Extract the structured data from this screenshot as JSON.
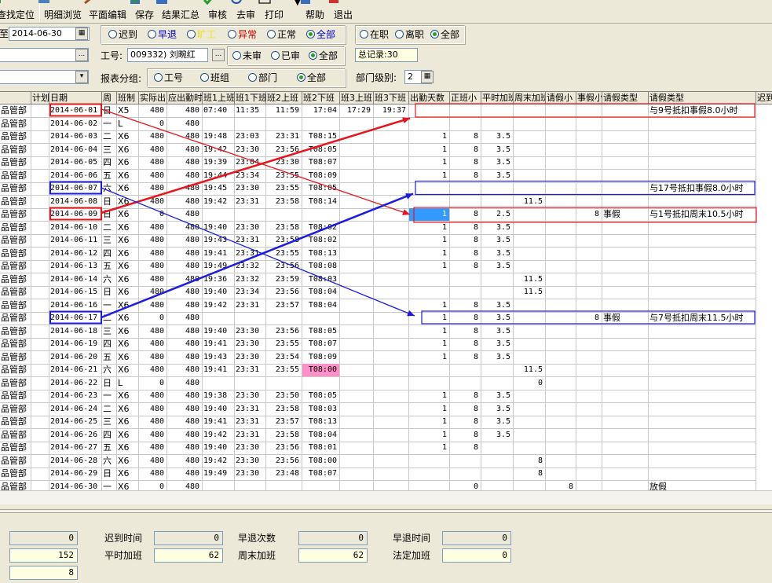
{
  "toolbar": {
    "items": [
      {
        "label": "查找定位",
        "icon": "search-icon"
      },
      {
        "label": "明细浏览",
        "icon": "list-icon"
      },
      {
        "label": "平面编辑",
        "icon": "edit-icon"
      },
      {
        "label": "保存",
        "icon": "save-icon"
      },
      {
        "label": "结果汇总",
        "icon": "summary-icon"
      },
      {
        "label": "审核",
        "icon": "check-icon"
      },
      {
        "label": "去审",
        "icon": "uncheck-icon"
      },
      {
        "label": "打印",
        "icon": "print-icon"
      },
      {
        "label": "帮助",
        "icon": "help-icon"
      },
      {
        "label": "退出",
        "icon": "exit-icon"
      }
    ]
  },
  "filters": {
    "date_to_prefix": "至",
    "date_to": "2014-06-30",
    "status_options": [
      {
        "label": "迟到",
        "selected": false,
        "color": "#000000"
      },
      {
        "label": "早退",
        "selected": false,
        "color": "#0000cc"
      },
      {
        "label": "旷工",
        "selected": false,
        "color": "#f0e020"
      },
      {
        "label": "异常",
        "selected": false,
        "color": "#cc0000"
      },
      {
        "label": "正常",
        "selected": false,
        "color": "#000000"
      },
      {
        "label": "全部",
        "selected": true,
        "color": "#0000cc"
      }
    ],
    "employment_options": [
      {
        "label": "在职",
        "selected": false
      },
      {
        "label": "离职",
        "selected": false
      },
      {
        "label": "全部",
        "selected": true
      }
    ],
    "employee_label": "工号:",
    "employee_value": "009332) 刘畹红",
    "audit_options": [
      {
        "label": "未审",
        "selected": false
      },
      {
        "label": "已审",
        "selected": false
      },
      {
        "label": "全部",
        "selected": true
      }
    ],
    "total_records": "总记录:30",
    "group_label": "报表分组:",
    "group_options": [
      {
        "label": "工号",
        "selected": false
      },
      {
        "label": "班组",
        "selected": false
      },
      {
        "label": "部门",
        "selected": false
      },
      {
        "label": "全部",
        "selected": true
      }
    ],
    "dept_level_label": "部门级别:",
    "dept_level_value": "2"
  },
  "table": {
    "headers": [
      "",
      "计划",
      "日期",
      "周",
      "班制",
      "实际出",
      "应出勤时",
      "班1上班",
      "班1下班",
      "班2上班",
      "班2下班",
      "班3上班",
      "班3下班",
      "出勤天数",
      "正班小",
      "平时加班",
      "周末加班",
      "请假小",
      "事假小",
      "请假类型",
      "请假类型",
      "迟到"
    ],
    "rows": [
      [
        "品管部",
        "",
        "2014-06-01",
        "日",
        "X5",
        "480",
        "480",
        "07:40",
        "11:35",
        "11:59",
        "17:04",
        "17:29",
        "19:37",
        "",
        "",
        "",
        "",
        "",
        "",
        "",
        "与9号抵扣事假8.0小时"
      ],
      [
        "品管部",
        "",
        "2014-06-02",
        "一",
        "L",
        "0",
        "480",
        "",
        "",
        "",
        "",
        "",
        "",
        "",
        "",
        "",
        "",
        "",
        "",
        "",
        ""
      ],
      [
        "品管部",
        "",
        "2014-06-03",
        "二",
        "X6",
        "480",
        "480",
        "19:48",
        "23:03",
        "23:31",
        "T08:15",
        "",
        "",
        "1",
        "8",
        "3.5",
        "",
        "",
        "",
        "",
        ""
      ],
      [
        "品管部",
        "",
        "2014-06-04",
        "三",
        "X6",
        "480",
        "480",
        "19:42",
        "23:30",
        "23:56",
        "T08:05",
        "",
        "",
        "1",
        "8",
        "3.5",
        "",
        "",
        "",
        "",
        ""
      ],
      [
        "品管部",
        "",
        "2014-06-05",
        "四",
        "X6",
        "480",
        "480",
        "19:39",
        "23:04",
        "23:30",
        "T08:07",
        "",
        "",
        "1",
        "8",
        "3.5",
        "",
        "",
        "",
        "",
        ""
      ],
      [
        "品管部",
        "",
        "2014-06-06",
        "五",
        "X6",
        "480",
        "480",
        "19:44",
        "23:34",
        "23:55",
        "T08:09",
        "",
        "",
        "1",
        "8",
        "3.5",
        "",
        "",
        "",
        "",
        ""
      ],
      [
        "品管部",
        "",
        "2014-06-07",
        "六",
        "X6",
        "480",
        "480",
        "19:45",
        "23:30",
        "23:55",
        "T08:05",
        "",
        "",
        "",
        "",
        "",
        "",
        "",
        "",
        "",
        "与17号抵扣事假8.0小时"
      ],
      [
        "品管部",
        "",
        "2014-06-08",
        "日",
        "X6",
        "480",
        "480",
        "19:42",
        "23:31",
        "23:58",
        "T08:14",
        "",
        "",
        "",
        "",
        "",
        "11.5",
        "",
        "",
        "",
        ""
      ],
      [
        "品管部",
        "",
        "2014-06-09",
        "日",
        "X6",
        "0",
        "480",
        "",
        "",
        "",
        "",
        "",
        "",
        "1",
        "8",
        "2.5",
        "",
        "",
        "8",
        "事假",
        "与1号抵扣周末10.5小时"
      ],
      [
        "品管部",
        "",
        "2014-06-10",
        "二",
        "X6",
        "480",
        "480",
        "19:40",
        "23:30",
        "23:58",
        "T08:02",
        "",
        "",
        "1",
        "8",
        "3.5",
        "",
        "",
        "",
        "",
        ""
      ],
      [
        "品管部",
        "",
        "2014-06-11",
        "三",
        "X6",
        "480",
        "480",
        "19:43",
        "23:31",
        "23:58",
        "T08:02",
        "",
        "",
        "1",
        "8",
        "3.5",
        "",
        "",
        "",
        "",
        ""
      ],
      [
        "品管部",
        "",
        "2014-06-12",
        "四",
        "X6",
        "480",
        "480",
        "19:41",
        "23:31",
        "23:55",
        "T08:13",
        "",
        "",
        "1",
        "8",
        "3.5",
        "",
        "",
        "",
        "",
        ""
      ],
      [
        "品管部",
        "",
        "2014-06-13",
        "五",
        "X6",
        "480",
        "480",
        "19:49",
        "23:32",
        "23:56",
        "T08:08",
        "",
        "",
        "1",
        "8",
        "3.5",
        "",
        "",
        "",
        "",
        ""
      ],
      [
        "品管部",
        "",
        "2014-06-14",
        "六",
        "X6",
        "480",
        "480",
        "19:36",
        "23:32",
        "23:59",
        "T08:03",
        "",
        "",
        "",
        "",
        "",
        "11.5",
        "",
        "",
        "",
        ""
      ],
      [
        "品管部",
        "",
        "2014-06-15",
        "日",
        "X6",
        "480",
        "480",
        "19:40",
        "23:34",
        "23:56",
        "T08:04",
        "",
        "",
        "",
        "",
        "",
        "11.5",
        "",
        "",
        "",
        ""
      ],
      [
        "品管部",
        "",
        "2014-06-16",
        "一",
        "X6",
        "480",
        "480",
        "19:42",
        "23:31",
        "23:57",
        "T08:04",
        "",
        "",
        "1",
        "8",
        "3.5",
        "",
        "",
        "",
        "",
        ""
      ],
      [
        "品管部",
        "",
        "2014-06-17",
        "二",
        "X6",
        "0",
        "480",
        "",
        "",
        "",
        "",
        "",
        "",
        "1",
        "8",
        "3.5",
        "",
        "",
        "8",
        "事假",
        "与7号抵扣周末11.5小时"
      ],
      [
        "品管部",
        "",
        "2014-06-18",
        "三",
        "X6",
        "480",
        "480",
        "19:40",
        "23:30",
        "23:56",
        "T08:05",
        "",
        "",
        "1",
        "8",
        "3.5",
        "",
        "",
        "",
        "",
        ""
      ],
      [
        "品管部",
        "",
        "2014-06-19",
        "四",
        "X6",
        "480",
        "480",
        "19:41",
        "23:30",
        "23:55",
        "T08:07",
        "",
        "",
        "1",
        "8",
        "3.5",
        "",
        "",
        "",
        "",
        ""
      ],
      [
        "品管部",
        "",
        "2014-06-20",
        "五",
        "X6",
        "480",
        "480",
        "19:43",
        "23:30",
        "23:54",
        "T08:09",
        "",
        "",
        "1",
        "8",
        "3.5",
        "",
        "",
        "",
        "",
        ""
      ],
      [
        "品管部",
        "",
        "2014-06-21",
        "六",
        "X6",
        "480",
        "480",
        "19:41",
        "23:31",
        "23:55",
        "T08:00",
        "",
        "",
        "",
        "",
        "",
        "11.5",
        "",
        "",
        "",
        ""
      ],
      [
        "品管部",
        "",
        "2014-06-22",
        "日",
        "L",
        "0",
        "480",
        "",
        "",
        "",
        "",
        "",
        "",
        "",
        "",
        "",
        "0",
        "",
        "",
        "",
        ""
      ],
      [
        "品管部",
        "",
        "2014-06-23",
        "一",
        "X6",
        "480",
        "480",
        "19:38",
        "23:30",
        "23:50",
        "T08:05",
        "",
        "",
        "1",
        "8",
        "3.5",
        "",
        "",
        "",
        "",
        ""
      ],
      [
        "品管部",
        "",
        "2014-06-24",
        "二",
        "X6",
        "480",
        "480",
        "19:40",
        "23:31",
        "23:58",
        "T08:03",
        "",
        "",
        "1",
        "8",
        "3.5",
        "",
        "",
        "",
        "",
        ""
      ],
      [
        "品管部",
        "",
        "2014-06-25",
        "三",
        "X6",
        "480",
        "480",
        "19:41",
        "23:31",
        "23:57",
        "T08:13",
        "",
        "",
        "1",
        "8",
        "3.5",
        "",
        "",
        "",
        "",
        ""
      ],
      [
        "品管部",
        "",
        "2014-06-26",
        "四",
        "X6",
        "480",
        "480",
        "19:42",
        "23:31",
        "23:58",
        "T08:04",
        "",
        "",
        "1",
        "8",
        "3.5",
        "",
        "",
        "",
        "",
        ""
      ],
      [
        "品管部",
        "",
        "2014-06-27",
        "五",
        "X6",
        "480",
        "480",
        "19:40",
        "23:30",
        "23:56",
        "T08:01",
        "",
        "",
        "1",
        "8",
        "",
        "",
        "",
        "",
        "",
        ""
      ],
      [
        "品管部",
        "",
        "2014-06-28",
        "六",
        "X6",
        "480",
        "480",
        "19:42",
        "23:30",
        "23:56",
        "T08:00",
        "",
        "",
        "",
        "",
        "",
        "8",
        "",
        "",
        "",
        ""
      ],
      [
        "品管部",
        "",
        "2014-06-29",
        "日",
        "X6",
        "480",
        "480",
        "19:49",
        "23:30",
        "23:48",
        "T08:07",
        "",
        "",
        "",
        "",
        "",
        "8",
        "",
        "",
        "",
        ""
      ],
      [
        "品管部",
        "",
        "2014-06-30",
        "一",
        "X6",
        "0",
        "480",
        "",
        "",
        "",
        "",
        "",
        "",
        "",
        "0",
        "",
        "",
        "8",
        "",
        "",
        "放假"
      ]
    ]
  },
  "summary": {
    "rows": [
      [
        {
          "label": "",
          "value": "0",
          "style": "gray"
        },
        {
          "label": "迟到时间",
          "value": "0",
          "style": "gray"
        },
        {
          "label": "早退次数",
          "value": "0",
          "style": "gray"
        },
        {
          "label": "早退时间",
          "value": "0",
          "style": "gray"
        }
      ],
      [
        {
          "label": "",
          "value": "152",
          "style": "yellow"
        },
        {
          "label": "平时加班",
          "value": "62",
          "style": "yellow"
        },
        {
          "label": "周末加班",
          "value": "62",
          "style": "yellow"
        },
        {
          "label": "法定加班",
          "value": "0",
          "style": "yellow"
        }
      ],
      [
        {
          "label": "",
          "value": "8",
          "style": "yellow"
        }
      ]
    ]
  },
  "colors": {
    "highlight_red": "#e8141c",
    "highlight_blue": "#1c1ce0",
    "pink_cell": "#ff8fc8",
    "selected_cell": "#3399ff"
  }
}
